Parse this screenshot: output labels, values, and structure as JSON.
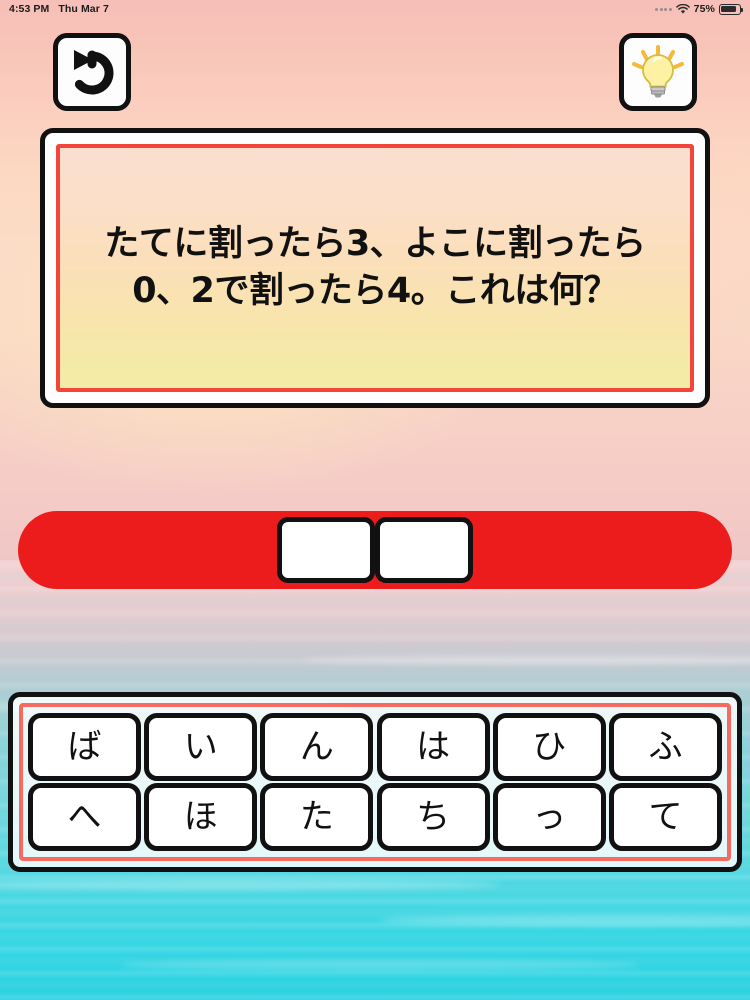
{
  "status_bar": {
    "time": "4:53 PM",
    "date": "Thu Mar 7",
    "battery_percent": "75%",
    "signal_icon": "signal-dots-icon",
    "wifi_icon": "wifi-icon",
    "battery_icon": "battery-icon"
  },
  "toolbar": {
    "undo_label": "undo-arrow-icon",
    "hint_label": "lightbulb-icon"
  },
  "question": {
    "text": "たてに割ったら3、よこに割ったら\n0、2で割ったら4。これは何？",
    "panel_border_color": "#f4453c"
  },
  "answer": {
    "bar_color": "#ec1c1c",
    "slots": [
      "",
      ""
    ]
  },
  "keyboard": {
    "border_color": "#f76a60",
    "rows": [
      [
        "ば",
        "い",
        "ん",
        "は",
        "ひ",
        "ふ"
      ],
      [
        "へ",
        "ほ",
        "た",
        "ち",
        "っ",
        "て"
      ]
    ]
  }
}
